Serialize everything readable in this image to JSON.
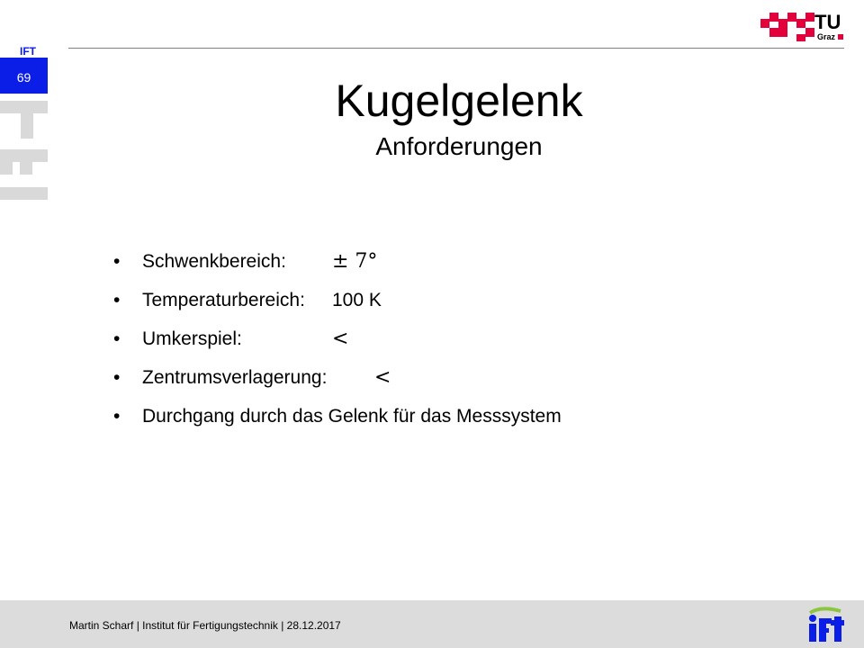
{
  "slide": {
    "page_number": "69",
    "mini_logo_text": "IFT",
    "title": "Kugelgelenk",
    "subtitle": "Anforderungen"
  },
  "bullets": [
    {
      "label": "Schwenkbereich:",
      "value": "± 7°"
    },
    {
      "label": "Temperaturbereich:",
      "value": "100 K"
    },
    {
      "label": "Umkerspiel:",
      "value": "<"
    },
    {
      "label": "Zentrumsverlagerung:",
      "value": "<"
    },
    {
      "label": "Durchgang durch das Gelenk für das Messsystem",
      "value": ""
    }
  ],
  "footer": {
    "text": "Martin Scharf | Institut für Fertigungstechnik | 28.12.2017"
  },
  "logos": {
    "tu_main": "TU",
    "tu_sub": "Graz"
  },
  "colors": {
    "tug_red": "#e4003a",
    "ift_blue": "#0b1ee8",
    "footer_gray": "#dcdcdc",
    "watermark_gray": "#d9d9d9",
    "ift_green": "#8cc63f"
  },
  "icons": {
    "bullet": "bullet-dot"
  }
}
